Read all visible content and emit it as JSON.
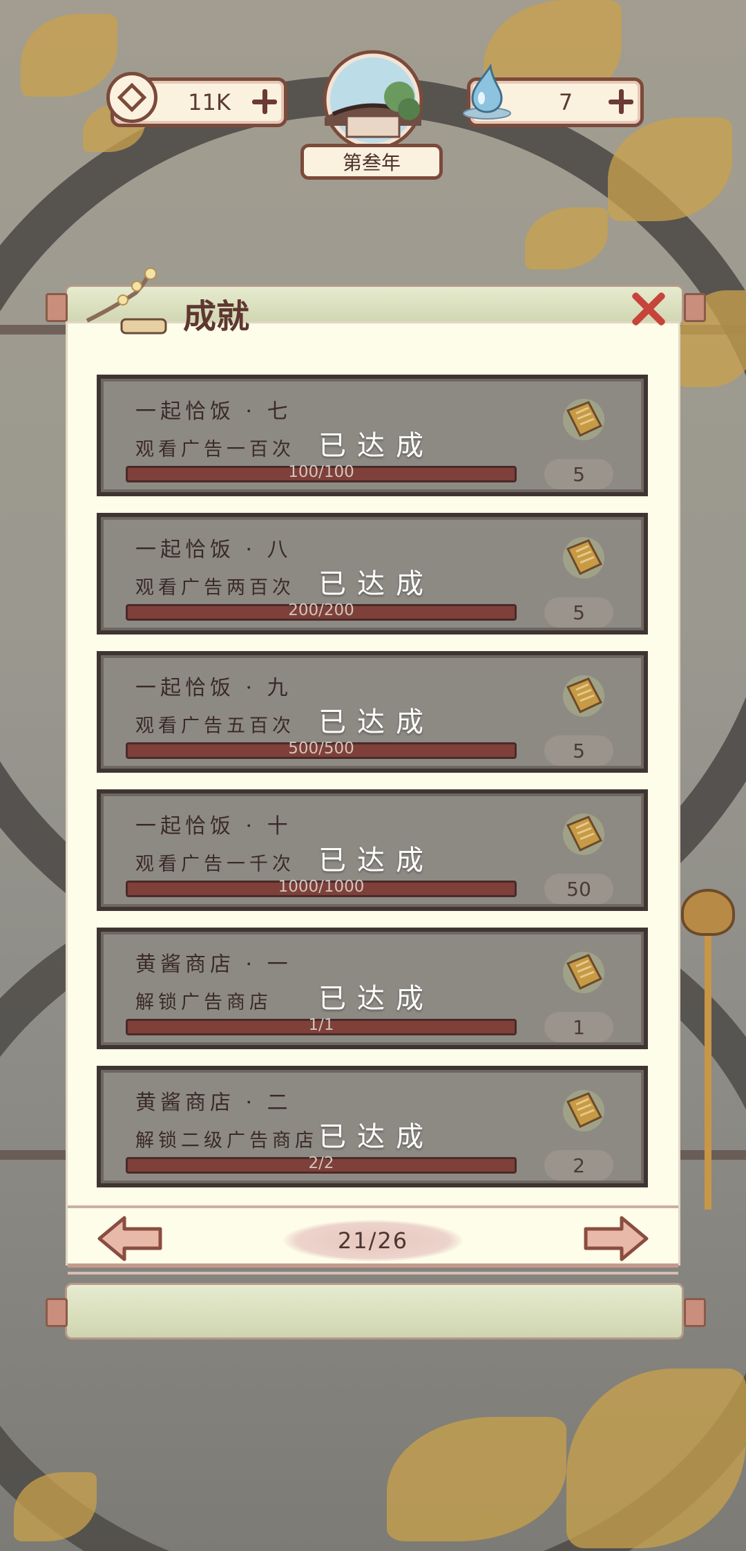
{
  "hud": {
    "coins": "11K",
    "water": "7",
    "year": "第叁年"
  },
  "panel": {
    "title": "成就"
  },
  "achievements": [
    {
      "name": "一起恰饭 · 七",
      "desc": "观看广告一百次",
      "status": "已达成",
      "progress_text": "100/100",
      "progress": 1.0,
      "reward": "5"
    },
    {
      "name": "一起恰饭 · 八",
      "desc": "观看广告两百次",
      "status": "已达成",
      "progress_text": "200/200",
      "progress": 1.0,
      "reward": "5"
    },
    {
      "name": "一起恰饭 · 九",
      "desc": "观看广告五百次",
      "status": "已达成",
      "progress_text": "500/500",
      "progress": 1.0,
      "reward": "5"
    },
    {
      "name": "一起恰饭 · 十",
      "desc": "观看广告一千次",
      "status": "已达成",
      "progress_text": "1000/1000",
      "progress": 1.0,
      "reward": "50"
    },
    {
      "name": "黄酱商店 · 一",
      "desc": "解锁广告商店",
      "status": "已达成",
      "progress_text": "1/1",
      "progress": 1.0,
      "reward": "1"
    },
    {
      "name": "黄酱商店 · 二",
      "desc": "解锁二级广告商店",
      "status": "已达成",
      "progress_text": "2/2",
      "progress": 1.0,
      "reward": "2"
    }
  ],
  "pager": {
    "page": "21/26"
  },
  "icons": {
    "coin": "coin-icon",
    "water": "water-drop-icon",
    "year_badge": "pavilion-icon",
    "title_deco": "bonsai-icon",
    "close": "close-icon",
    "reward": "ticket-icon",
    "prev": "arrow-left-icon",
    "next": "arrow-right-icon"
  },
  "colors": {
    "frame": "#7b4a3a",
    "panel": "#fdfde9",
    "card": "#8d8a84",
    "close": "#c6443a"
  }
}
